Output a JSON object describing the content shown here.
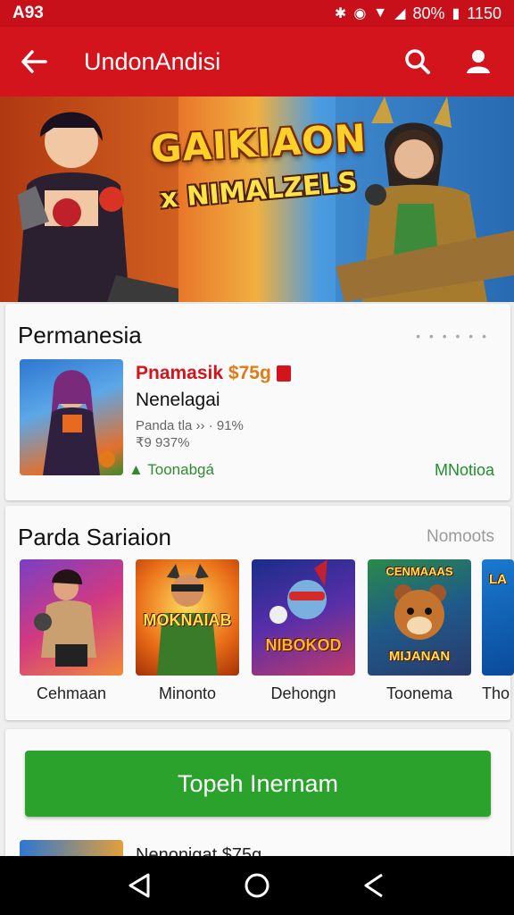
{
  "status": {
    "left": "A93",
    "battery": "80%",
    "time": "1150"
  },
  "app_bar": {
    "title": "UndonAndisi"
  },
  "banner": {
    "title": "GAIKIAON",
    "subtitle": "x NIMALZELS"
  },
  "section1": {
    "title": "Permanesia",
    "app": {
      "name": "Pnamasik",
      "price": "$75g",
      "subtitle": "Nenelagai",
      "meta1": "Panda tla ›› · 91%",
      "meta2": "₹9 937%",
      "developer": "Toonabgá",
      "action": "MNotioa"
    }
  },
  "section2": {
    "title": "Parda Sariaion",
    "more": "Nomoots",
    "games": [
      {
        "label": "Cehmaan",
        "tile_text": ""
      },
      {
        "label": "Minonto",
        "tile_text": "MOKNAIAB"
      },
      {
        "label": "Dehongn",
        "tile_text": "NIBOKOD"
      },
      {
        "label": "Toonema",
        "tile_text": "MIJANAN"
      },
      {
        "label": "Tho",
        "tile_text": "LA"
      }
    ]
  },
  "install": {
    "label": "Topeh Inernam"
  },
  "peek": {
    "text": "Nenonigat $75g"
  },
  "colors": {
    "primary": "#d4141d",
    "install": "#2aa22c",
    "price": "#e07a14"
  }
}
